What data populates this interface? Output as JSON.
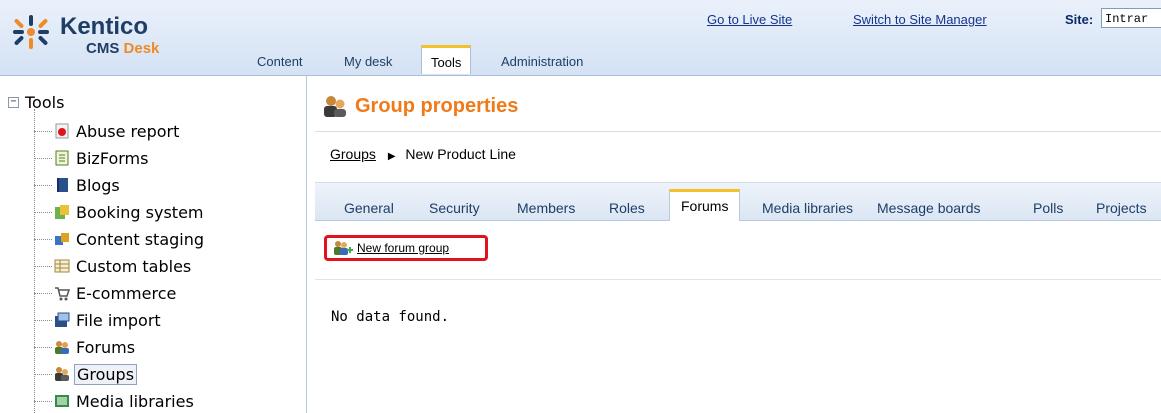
{
  "header": {
    "logo": {
      "name": "Kentico",
      "sub_cms": "CMS",
      "sub_desk": "Desk"
    },
    "top_links": {
      "live_site": "Go to Live Site",
      "site_manager": "Switch to Site Manager",
      "site_label": "Site:",
      "site_value": "Intrar"
    },
    "tabs": [
      {
        "label": "Content"
      },
      {
        "label": "My desk"
      },
      {
        "label": "Tools",
        "active": true
      },
      {
        "label": "Administration"
      }
    ]
  },
  "tree": {
    "root": {
      "toggle": "−",
      "label": "Tools"
    },
    "items": [
      {
        "label": "Abuse report",
        "icon": "abuse-report-icon"
      },
      {
        "label": "BizForms",
        "icon": "bizforms-icon"
      },
      {
        "label": "Blogs",
        "icon": "blogs-icon"
      },
      {
        "label": "Booking system",
        "icon": "booking-system-icon"
      },
      {
        "label": "Content staging",
        "icon": "content-staging-icon"
      },
      {
        "label": "Custom tables",
        "icon": "custom-tables-icon"
      },
      {
        "label": "E-commerce",
        "icon": "ecommerce-icon"
      },
      {
        "label": "File import",
        "icon": "file-import-icon"
      },
      {
        "label": "Forums",
        "icon": "forums-icon"
      },
      {
        "label": "Groups",
        "icon": "groups-icon",
        "selected": true
      },
      {
        "label": "Media libraries",
        "icon": "media-libraries-icon"
      }
    ]
  },
  "content": {
    "title": "Group properties",
    "breadcrumb": {
      "parent": "Groups",
      "current": "New Product Line"
    },
    "tabs": [
      {
        "label": "General"
      },
      {
        "label": "Security"
      },
      {
        "label": "Members"
      },
      {
        "label": "Roles"
      },
      {
        "label": "Forums",
        "active": true
      },
      {
        "label": "Media libraries"
      },
      {
        "label": "Message boards"
      },
      {
        "label": "Polls"
      },
      {
        "label": "Projects"
      }
    ],
    "action": {
      "label": "New forum group",
      "icon": "new-forum-group-icon"
    },
    "empty_message": "No data found."
  },
  "colors": {
    "title_orange": "#f07a1a",
    "active_tab_accent": "#f3c22b",
    "highlight_red": "#e0131a",
    "logo_blue": "#1f3e66",
    "link_blue": "#15348c"
  }
}
